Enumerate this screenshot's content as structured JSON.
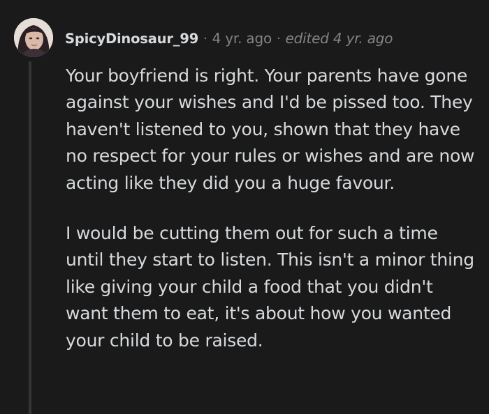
{
  "comment": {
    "author": "SpicyDinosaur_99",
    "separator": "·",
    "age": "4 yr. ago",
    "edited": "edited 4 yr. ago",
    "paragraphs": [
      "Your boyfriend is right. Your parents have gone against your wishes and I'd be pissed too. They haven't listened to you, shown that they have no respect for your rules or wishes and are now acting like they did you a huge favour.",
      "I would be cutting them out for such a time until they start to listen. This isn't a minor thing like giving your child a food that you didn't want them to eat, it's about how you wanted your child to be raised."
    ]
  },
  "colors": {
    "background": "#1a1a1b",
    "text": "#d7dadc",
    "meta": "#818384",
    "thread_line": "#343536"
  },
  "icons": {
    "avatar": "user-avatar-photo"
  }
}
